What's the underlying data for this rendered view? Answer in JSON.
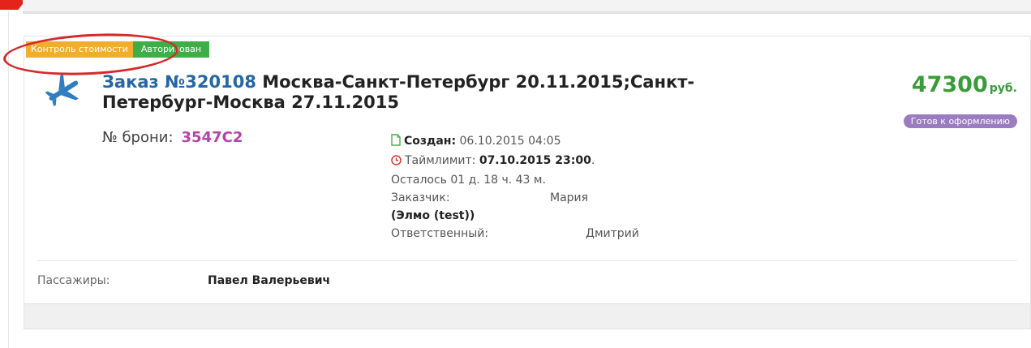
{
  "badges": {
    "cost_control": "Контроль стоимости",
    "authorized": "Авторизован"
  },
  "order": {
    "prefix": "Заказ",
    "number": "№320108",
    "route": " Москва-Санкт-Петербург 20.11.2015;Санкт-Петербург-Москва 27.11.2015",
    "price_value": "47300",
    "price_currency": "руб.",
    "status": "Готов к оформлению",
    "booking_label": "№ брони:",
    "booking_value": "3547C2"
  },
  "details": {
    "created_label": "Создан:",
    "created_value": "06.10.2015 04:05",
    "timelimit_label": "Таймлимит:",
    "timelimit_value": "07.10.2015 23:00",
    "timelimit_suffix": ".",
    "remaining": "Осталось 01 д. 18 ч. 43 м.",
    "customer_label": "Заказчик:",
    "customer_value": "Мария",
    "customer_org": "(Элмо (test))",
    "responsible_label": "Ответственный:",
    "responsible_value": "Дмитрий"
  },
  "passengers": {
    "label": "Пассажиры:",
    "value": "Павел Валерьевич"
  },
  "colors": {
    "badge_cost": "#f0ad2e",
    "badge_auth": "#3fae49",
    "price": "#3a9b3a",
    "status": "#9b7cc0",
    "booking": "#b443a8",
    "link": "#2566a3",
    "highlight": "#d42a2a"
  },
  "icons": {
    "plane": "airplane-icon",
    "document": "document-icon",
    "clock": "clock-icon"
  }
}
